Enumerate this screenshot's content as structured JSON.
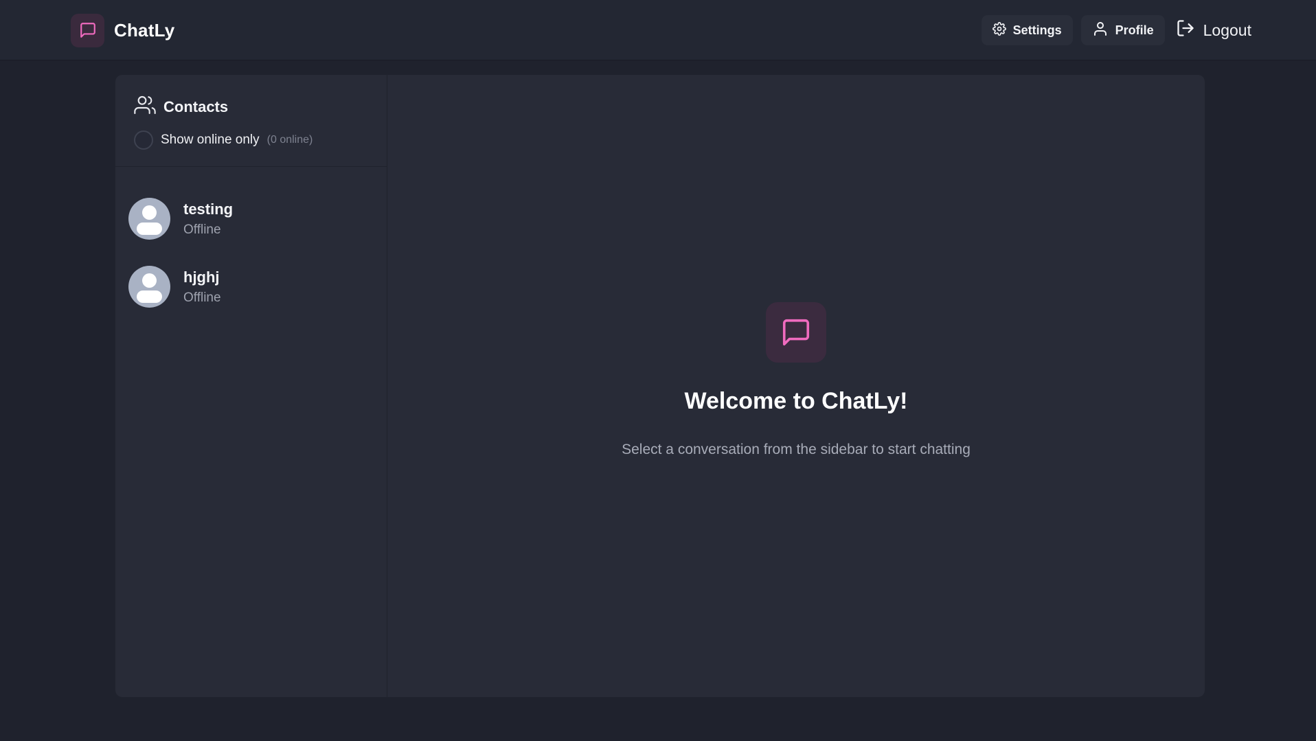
{
  "app": {
    "name": "ChatLy"
  },
  "colors": {
    "accent": "#f06bbf",
    "background": "#1f222d",
    "panel": "#282b37"
  },
  "header": {
    "logo_icon": "message-square-icon",
    "settings_label": "Settings",
    "settings_icon": "gear-icon",
    "profile_label": "Profile",
    "profile_icon": "user-icon",
    "logout_label": "Logout",
    "logout_icon": "logout-icon"
  },
  "sidebar": {
    "title": "Contacts",
    "title_icon": "users-icon",
    "filter_label": "Show online only",
    "filter_checked": false,
    "online_count": "(0 online)",
    "contacts": [
      {
        "name": "testing",
        "status": "Offline"
      },
      {
        "name": "hjghj",
        "status": "Offline"
      }
    ]
  },
  "welcome": {
    "icon": "message-square-icon",
    "title": "Welcome to ChatLy!",
    "subtitle": "Select a conversation from the sidebar to start chatting"
  }
}
